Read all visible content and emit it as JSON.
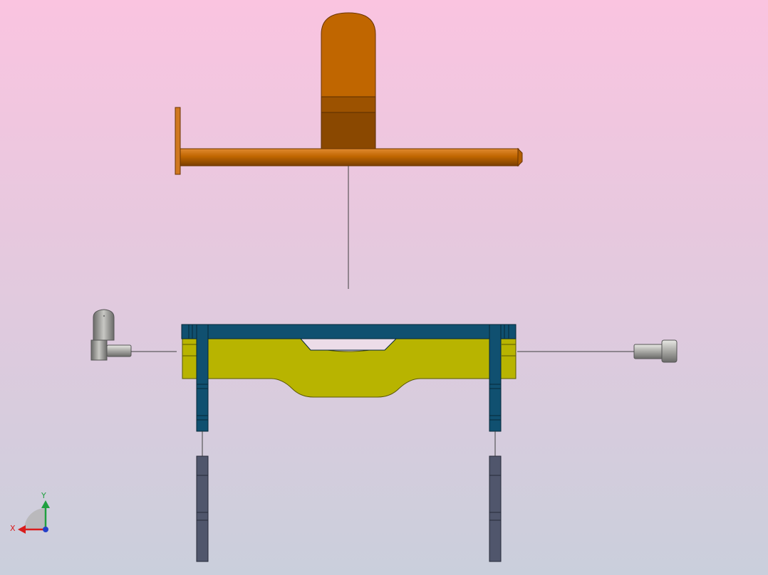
{
  "viewport": {
    "background_top": "#fac4e0",
    "background_bottom": "#cacfdc"
  },
  "triad": {
    "x_label": "X",
    "y_label": "Y",
    "x_color": "#d91c1c",
    "y_color": "#20a040",
    "z_color": "#2440c8"
  },
  "colors": {
    "orange": "#c06600",
    "orange_dark": "#8a4800",
    "yellow": "#b8b400",
    "teal": "#105070",
    "gray": "#50566c",
    "screw_gray": "#a8a8a8",
    "line": "#404040"
  }
}
